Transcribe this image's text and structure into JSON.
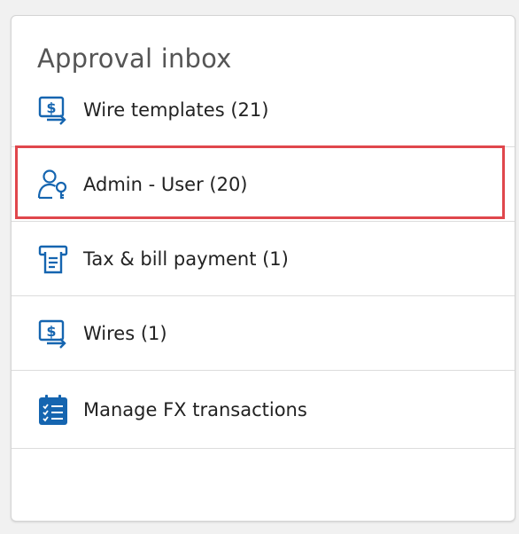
{
  "panel": {
    "title": "Approval inbox",
    "items": [
      {
        "label": "Wire templates (21)",
        "icon": "wire-transfer-icon"
      },
      {
        "label": "Admin - User (20)",
        "icon": "user-key-icon",
        "highlighted": true
      },
      {
        "label": "Tax & bill payment (1)",
        "icon": "receipt-icon"
      },
      {
        "label": "Wires (1)",
        "icon": "wire-transfer-icon"
      },
      {
        "label": "Manage FX transactions",
        "icon": "checklist-icon"
      }
    ]
  },
  "colors": {
    "icon_primary": "#1565b0",
    "highlight_border": "#e0474c",
    "text": "#222222",
    "title": "#555555"
  }
}
